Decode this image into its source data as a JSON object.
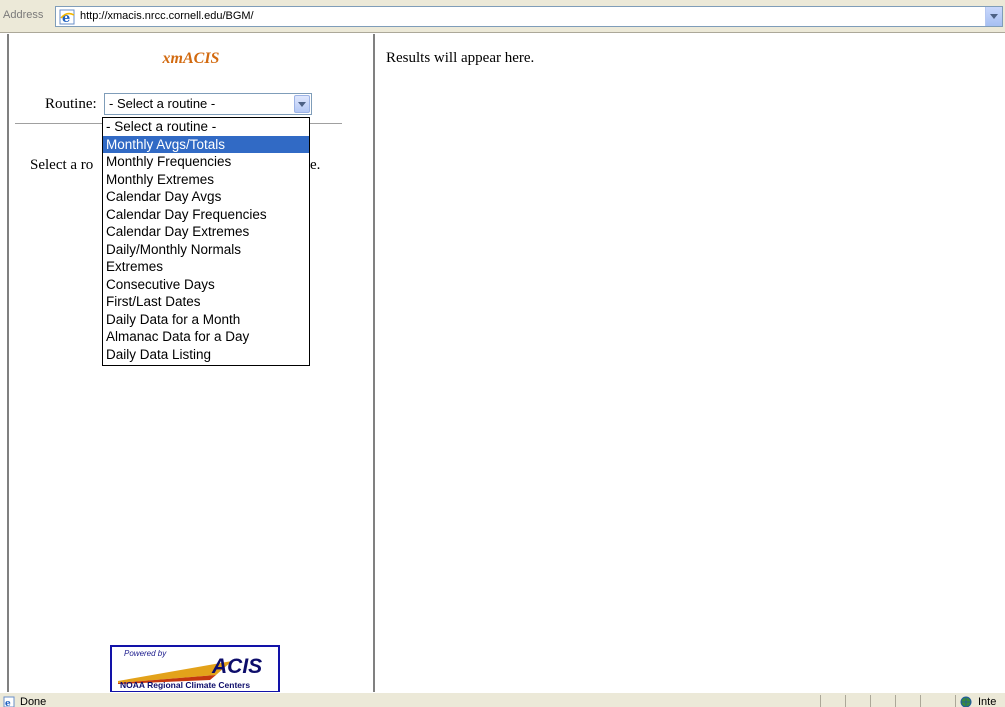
{
  "browser": {
    "address_label": "Address",
    "url": "http://xmacis.nrcc.cornell.edu/BGM/",
    "status_text": "Done",
    "zone_text": "Inte"
  },
  "app": {
    "title": "xmACIS",
    "routine_label": "Routine:",
    "routine_selected": "- Select a routine -",
    "instructions_visible": "Select a ro",
    "instructions_tail": "re.",
    "routine_options": [
      "- Select a routine -",
      "Monthly Avgs/Totals",
      "Monthly Frequencies",
      "Monthly Extremes",
      "Calendar Day Avgs",
      "Calendar Day Frequencies",
      "Calendar Day Extremes",
      "Daily/Monthly Normals",
      "Extremes",
      "Consecutive Days",
      "First/Last Dates",
      "Daily Data for a Month",
      "Almanac Data for a Day",
      "Daily Data Listing"
    ],
    "highlighted_option": "Monthly Avgs/Totals"
  },
  "logo": {
    "powered_by": "Powered by",
    "name": "ACIS",
    "subtitle": "NOAA Regional Climate Centers"
  },
  "results": {
    "placeholder": "Results will appear here."
  },
  "colors": {
    "title": "#d26a10",
    "highlight": "#316ac5",
    "logo_border": "#1212a8"
  }
}
